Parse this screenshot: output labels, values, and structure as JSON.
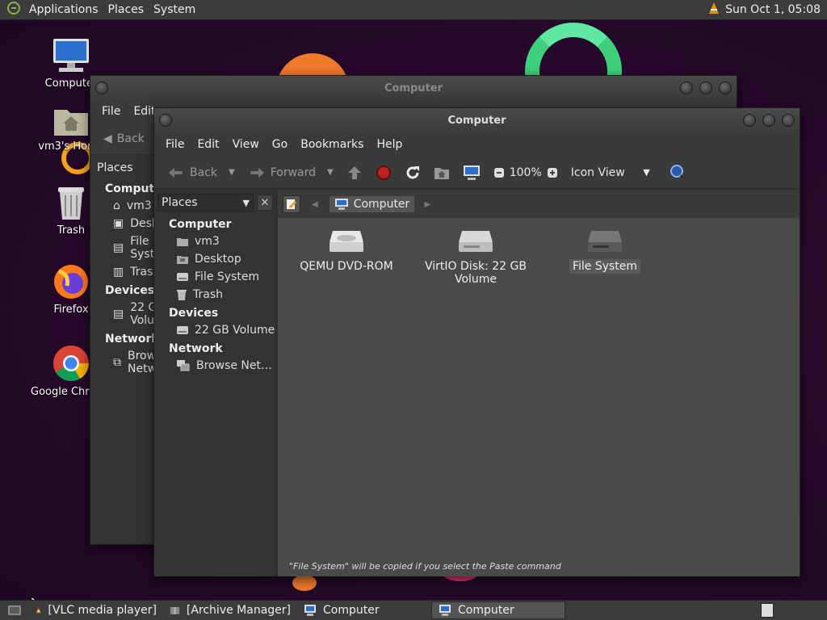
{
  "topbar": {
    "menus": [
      "Applications",
      "Places",
      "System"
    ],
    "clock": "Sun Oct  1, 05:08"
  },
  "desktop_icons": [
    {
      "label": "Computer",
      "icon": "computer-icon"
    },
    {
      "label": "vm3's Home",
      "icon": "home-folder-icon"
    },
    {
      "label": "Trash",
      "icon": "trash-icon"
    },
    {
      "label": "Firefox",
      "icon": "firefox-icon"
    },
    {
      "label": "Google Chrome",
      "icon": "chrome-icon"
    }
  ],
  "back_window": {
    "title": "Computer",
    "menus": [
      "File",
      "Edit"
    ],
    "toolbar": {
      "back": "Back"
    },
    "places_label": "Places",
    "sections": {
      "computer": "Computer",
      "devices": "Devices",
      "network": "Network"
    },
    "items": [
      "vm3",
      "Desktop",
      "File System",
      "Trash",
      "22 GB Volume",
      "Browse Network"
    ]
  },
  "window": {
    "title": "Computer",
    "menus": [
      "File",
      "Edit",
      "View",
      "Go",
      "Bookmarks",
      "Help"
    ],
    "toolbar": {
      "back": "Back",
      "forward": "Forward",
      "zoom": "100%",
      "view_mode": "Icon View"
    },
    "sidebar": {
      "combo_label": "Places",
      "sections": {
        "computer": "Computer",
        "devices": "Devices",
        "network": "Network"
      },
      "computer_items": [
        {
          "label": "vm3",
          "icon": "home-icon"
        },
        {
          "label": "Desktop",
          "icon": "desktop-icon"
        },
        {
          "label": "File System",
          "icon": "drive-icon"
        },
        {
          "label": "Trash",
          "icon": "trash-icon"
        }
      ],
      "device_items": [
        {
          "label": "22 GB Volume",
          "icon": "drive-icon"
        }
      ],
      "network_items": [
        {
          "label": "Browse Net…",
          "icon": "network-icon"
        }
      ]
    },
    "pathbar": {
      "location": "Computer"
    },
    "files": [
      {
        "label": "QEMU DVD-ROM",
        "icon": "optical-drive-icon"
      },
      {
        "label": "VirtIO Disk: 22 GB Volume",
        "icon": "hard-drive-icon"
      },
      {
        "label": "File System",
        "icon": "filesystem-drive-icon",
        "selected": true
      }
    ],
    "status": "\"File System\" will be copied if you select the Paste command"
  },
  "taskbar": {
    "tasks": [
      {
        "label": "[VLC media player]",
        "icon": "vlc-icon"
      },
      {
        "label": "[Archive Manager]",
        "icon": "archive-icon"
      },
      {
        "label": "Computer",
        "icon": "computer-icon"
      },
      {
        "label": "Computer",
        "icon": "computer-icon",
        "active": true
      }
    ]
  },
  "colors": {
    "panel": "#3c3c3c",
    "window_bg": "#333333",
    "content_bg": "#4a4a4a",
    "stop_red": "#c02020"
  }
}
